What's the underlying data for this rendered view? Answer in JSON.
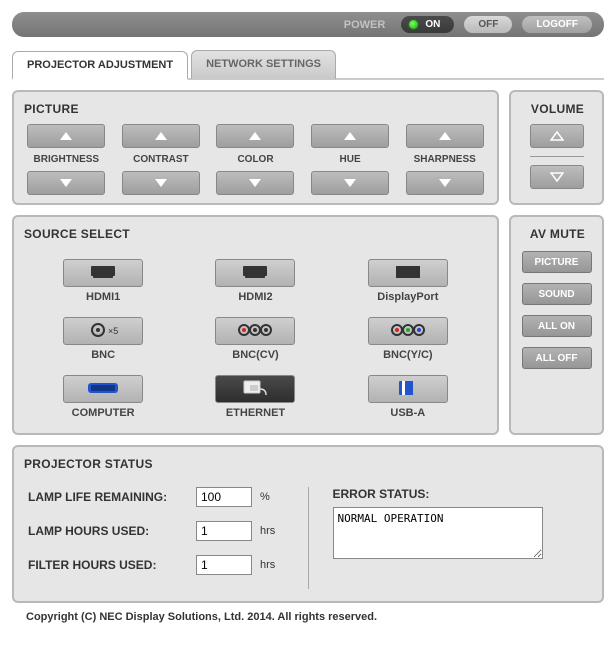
{
  "topbar": {
    "power_label": "POWER",
    "on_label": "ON",
    "off_label": "OFF",
    "logoff_label": "LOGOFF"
  },
  "tabs": {
    "projector": "PROJECTOR ADJUSTMENT",
    "network": "NETWORK SETTINGS"
  },
  "picture": {
    "title": "PICTURE",
    "items": [
      "BRIGHTNESS",
      "CONTRAST",
      "COLOR",
      "HUE",
      "SHARPNESS"
    ]
  },
  "volume": {
    "title": "VOLUME"
  },
  "source": {
    "title": "SOURCE SELECT",
    "items": [
      {
        "label": "HDMI1",
        "icon": "hdmi"
      },
      {
        "label": "HDMI2",
        "icon": "hdmi"
      },
      {
        "label": "DisplayPort",
        "icon": "dp"
      },
      {
        "label": "BNC",
        "icon": "bnc5"
      },
      {
        "label": "BNC(CV)",
        "icon": "bnc3r"
      },
      {
        "label": "BNC(Y/C)",
        "icon": "bnc3c"
      },
      {
        "label": "COMPUTER",
        "icon": "vga"
      },
      {
        "label": "ETHERNET",
        "icon": "eth",
        "dark": true
      },
      {
        "label": "USB-A",
        "icon": "usb"
      }
    ]
  },
  "avmute": {
    "title": "AV MUTE",
    "picture": "PICTURE",
    "sound": "SOUND",
    "allon": "ALL ON",
    "alloff": "ALL OFF"
  },
  "status": {
    "title": "PROJECTOR STATUS",
    "lamp_life_label": "LAMP LIFE REMAINING:",
    "lamp_life_value": "100",
    "lamp_life_unit": "%",
    "lamp_hours_label": "LAMP HOURS USED:",
    "lamp_hours_value": "1",
    "lamp_hours_unit": "hrs",
    "filter_hours_label": "FILTER HOURS USED:",
    "filter_hours_value": "1",
    "filter_hours_unit": "hrs",
    "error_label": "ERROR STATUS:",
    "error_value": "NORMAL OPERATION"
  },
  "copyright": "Copyright (C) NEC Display Solutions, Ltd. 2014. All rights reserved."
}
